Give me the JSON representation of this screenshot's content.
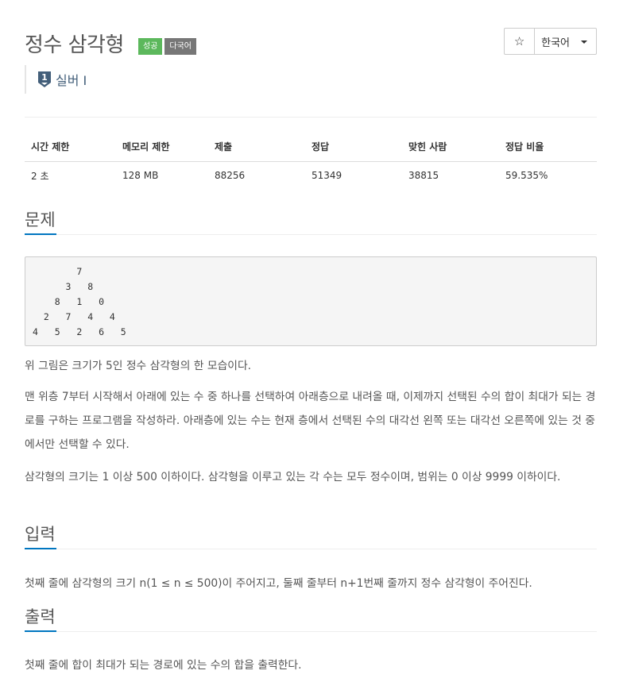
{
  "problem": {
    "title": "정수 삼각형",
    "badges": {
      "status": "성공",
      "multilang": "다국어"
    },
    "tier": "실버 I"
  },
  "toolbar": {
    "star_icon": "☆",
    "language": "한국어"
  },
  "info_table": {
    "headers": [
      "시간 제한",
      "메모리 제한",
      "제출",
      "정답",
      "맞힌 사람",
      "정답 비율"
    ],
    "values": [
      "2 초",
      "128 MB",
      "88256",
      "51349",
      "38815",
      "59.535%"
    ]
  },
  "sections": {
    "problem_title": "문제",
    "triangle_example": "        7\n      3   8\n    8   1   0\n  2   7   4   4\n4   5   2   6   5",
    "desc1": "위 그림은 크기가 5인 정수 삼각형의 한 모습이다.",
    "desc2": "맨 위층 7부터 시작해서 아래에 있는 수 중 하나를 선택하여 아래층으로 내려올 때, 이제까지 선택된 수의 합이 최대가 되는 경로를 구하는 프로그램을 작성하라. 아래층에 있는 수는 현재 층에서 선택된 수의 대각선 왼쪽 또는 대각선 오른쪽에 있는 것 중에서만 선택할 수 있다.",
    "desc3": "삼각형의 크기는 1 이상 500 이하이다. 삼각형을 이루고 있는 각 수는 모두 정수이며, 범위는 0 이상 9999 이하이다.",
    "input_title": "입력",
    "input_desc": "첫째 줄에 삼각형의 크기 n(1 ≤ n ≤ 500)이 주어지고, 둘째 줄부터 n+1번째 줄까지 정수 삼각형이 주어진다.",
    "output_title": "출력",
    "output_desc": "첫째 줄에 합이 최대가 되는 경로에 있는 수의 합을 출력한다."
  },
  "colors": {
    "accent": "#0076c0",
    "success": "#5cb85c",
    "muted_badge": "#777777",
    "tier_text": "#435f7a"
  }
}
